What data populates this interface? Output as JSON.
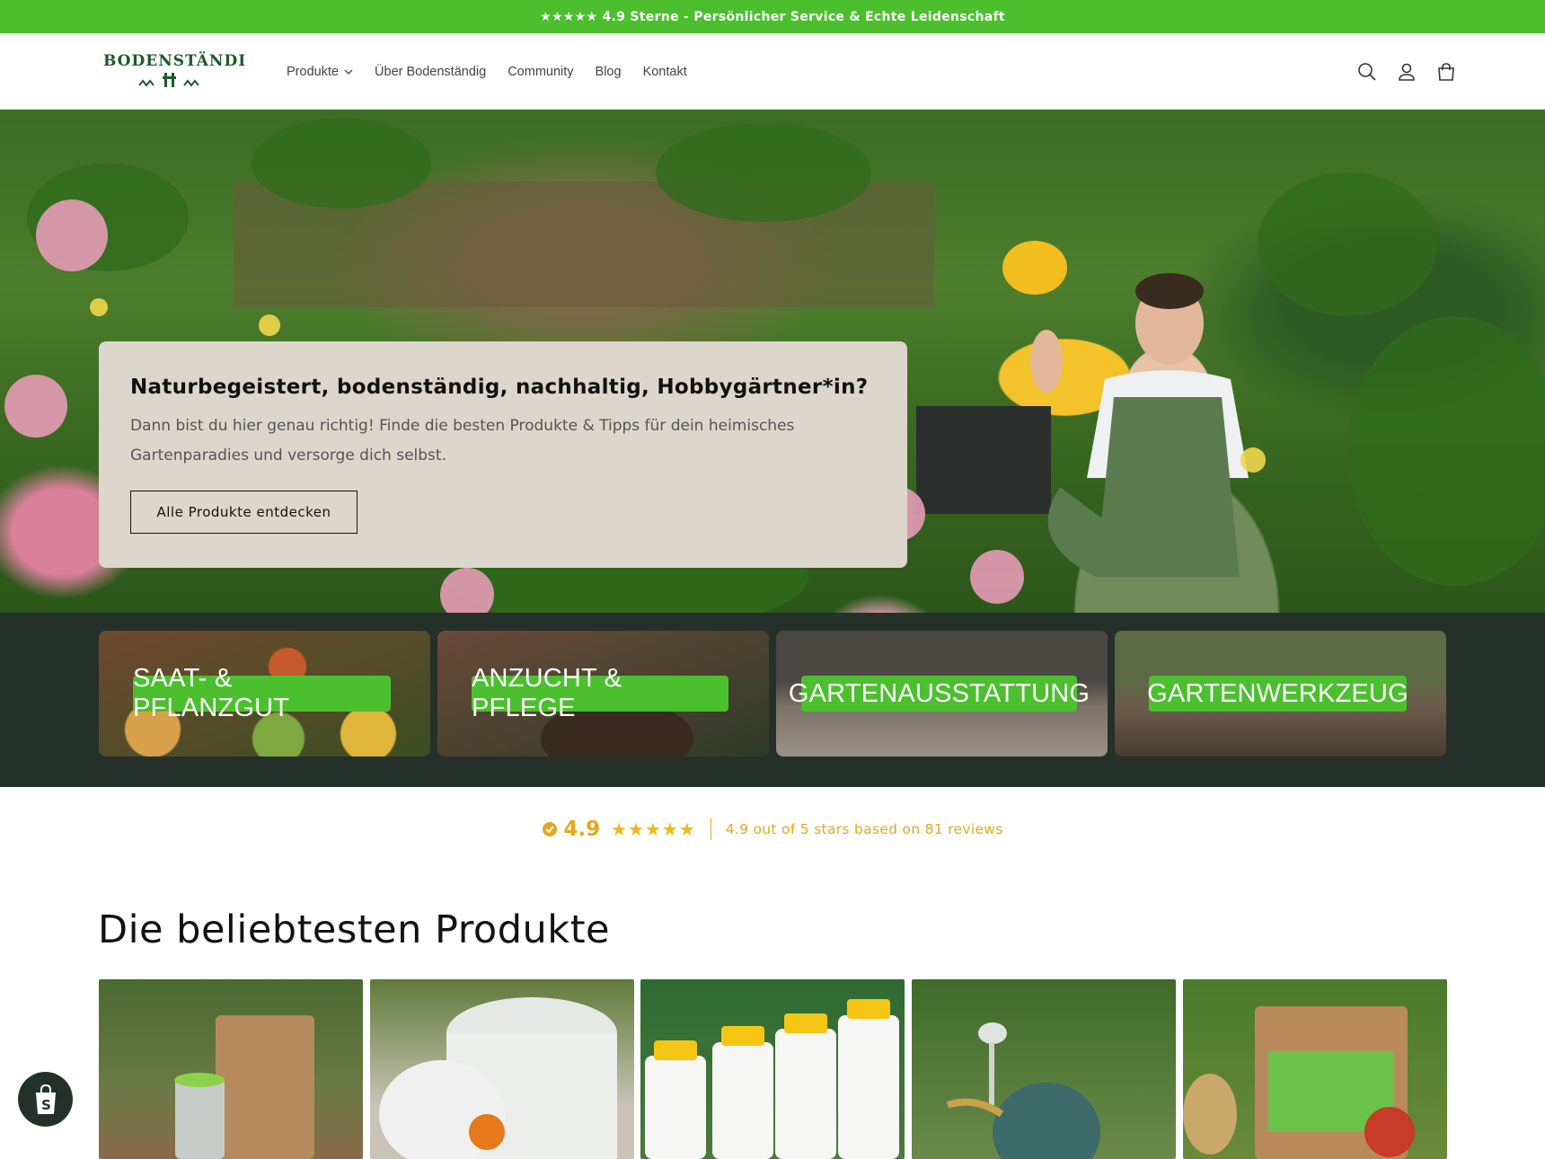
{
  "announcement": "★★★★★ 4.9 Sterne - Persönlicher Service & Echte Leidenschaft",
  "header": {
    "logo_text": "Bodenständig",
    "nav": [
      {
        "label": "Produkte",
        "has_dropdown": true
      },
      {
        "label": "Über Bodenständig"
      },
      {
        "label": "Community"
      },
      {
        "label": "Blog"
      },
      {
        "label": "Kontakt"
      }
    ],
    "icons": [
      "search-icon",
      "account-icon",
      "cart-icon"
    ]
  },
  "hero": {
    "title": "Naturbegeistert, bodenständig, nachhaltig, Hobbygärtner*in?",
    "subtitle": "Dann bist du hier genau richtig! Finde die besten Produkte & Tipps für dein heimisches Gartenparadies und versorge dich selbst.",
    "button": "Alle Produkte entdecken"
  },
  "categories": [
    {
      "label": "SAAT- & PFLANZGUT"
    },
    {
      "label": "ANZUCHT & PFLEGE"
    },
    {
      "label": "GARTENAUSSTATTUNG"
    },
    {
      "label": "GARTENWERKZEUG"
    }
  ],
  "rating": {
    "score": "4.9",
    "stars": "★★★★★",
    "text": "4.9 out of 5 stars based on 81 reviews"
  },
  "featured": {
    "title": "Die beliebtesten Produkte"
  },
  "colors": {
    "brand_green": "#4cbf2f",
    "dark_band": "#25302a",
    "hero_card": "#ddd6cc",
    "rating_gold": "#e3a81e"
  }
}
